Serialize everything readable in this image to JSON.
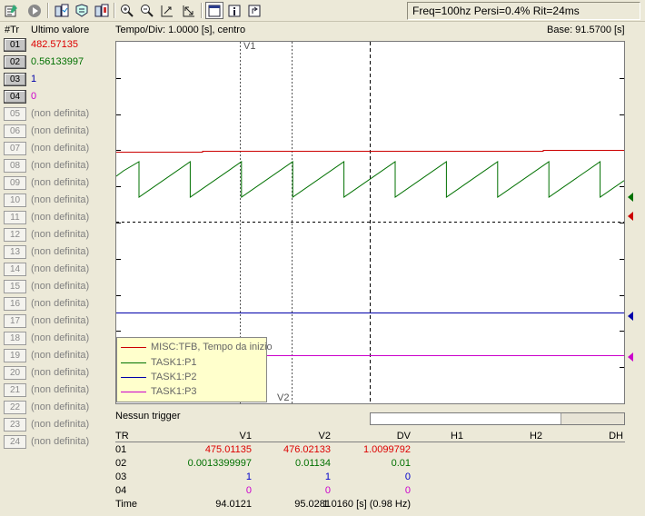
{
  "toolbar": {
    "buttons": [
      {
        "name": "props-button",
        "icon": "properties-icon"
      },
      {
        "name": "play-button",
        "icon": "play-icon"
      },
      {
        "name": "channels-button",
        "icon": "channels-icon"
      },
      {
        "name": "filter-button",
        "icon": "filter-icon"
      },
      {
        "name": "export-button",
        "icon": "export-icon"
      },
      {
        "name": "zoom-in-button",
        "icon": "zoom-in-icon"
      },
      {
        "name": "zoom-out-button",
        "icon": "zoom-out-icon"
      },
      {
        "name": "fit-button",
        "icon": "fit-icon"
      },
      {
        "name": "autoscale-button",
        "icon": "autoscale-icon"
      },
      {
        "name": "view-button",
        "icon": "window-icon"
      },
      {
        "name": "info-button",
        "icon": "info-icon"
      },
      {
        "name": "popout-button",
        "icon": "popout-icon"
      }
    ],
    "status": "Freq=100hz Persi=0.4% Rit=24ms"
  },
  "left": {
    "col_tr": "#Tr",
    "col_value": "Ultimo valore",
    "rows": [
      {
        "id": "01",
        "value": "482.57135",
        "active": true,
        "color": "#dd0000"
      },
      {
        "id": "02",
        "value": "0.56133997",
        "active": true,
        "color": "#007000"
      },
      {
        "id": "03",
        "value": "1",
        "active": true,
        "color": "#0000aa"
      },
      {
        "id": "04",
        "value": "0",
        "active": true,
        "color": "#cc00cc"
      },
      {
        "id": "05",
        "value": "(non definita)",
        "active": false,
        "color": "#808080"
      },
      {
        "id": "06",
        "value": "(non definita)",
        "active": false,
        "color": "#808080"
      },
      {
        "id": "07",
        "value": "(non definita)",
        "active": false,
        "color": "#808080"
      },
      {
        "id": "08",
        "value": "(non definita)",
        "active": false,
        "color": "#808080"
      },
      {
        "id": "09",
        "value": "(non definita)",
        "active": false,
        "color": "#808080"
      },
      {
        "id": "10",
        "value": "(non definita)",
        "active": false,
        "color": "#808080"
      },
      {
        "id": "11",
        "value": "(non definita)",
        "active": false,
        "color": "#808080"
      },
      {
        "id": "12",
        "value": "(non definita)",
        "active": false,
        "color": "#808080"
      },
      {
        "id": "13",
        "value": "(non definita)",
        "active": false,
        "color": "#808080"
      },
      {
        "id": "14",
        "value": "(non definita)",
        "active": false,
        "color": "#808080"
      },
      {
        "id": "15",
        "value": "(non definita)",
        "active": false,
        "color": "#808080"
      },
      {
        "id": "16",
        "value": "(non definita)",
        "active": false,
        "color": "#808080"
      },
      {
        "id": "17",
        "value": "(non definita)",
        "active": false,
        "color": "#808080"
      },
      {
        "id": "18",
        "value": "(non definita)",
        "active": false,
        "color": "#808080"
      },
      {
        "id": "19",
        "value": "(non definita)",
        "active": false,
        "color": "#808080"
      },
      {
        "id": "20",
        "value": "(non definita)",
        "active": false,
        "color": "#808080"
      },
      {
        "id": "21",
        "value": "(non definita)",
        "active": false,
        "color": "#808080"
      },
      {
        "id": "22",
        "value": "(non definita)",
        "active": false,
        "color": "#808080"
      },
      {
        "id": "23",
        "value": "(non definita)",
        "active": false,
        "color": "#808080"
      },
      {
        "id": "24",
        "value": "(non definita)",
        "active": false,
        "color": "#808080"
      }
    ]
  },
  "scope": {
    "tempo_div": "Tempo/Div: 1.0000 [s], centro",
    "base": "Base: 91.5700 [s]",
    "cursor_v1": "V1",
    "cursor_v2": "V2",
    "trigger": "Nessun trigger",
    "progress_fraction": 0.75
  },
  "chart_data": {
    "type": "line",
    "x_unit": "s",
    "xlim": [
      86.57,
      96.57
    ],
    "cursors": {
      "V1": 94.0121,
      "V2": 95.0281
    },
    "series": [
      {
        "name": "MISC:TFB, Tempo da inizio",
        "color": "#cc0000"
      },
      {
        "name": "TASK1:P1",
        "color": "#007000"
      },
      {
        "name": "TASK1:P2",
        "color": "#0000aa"
      },
      {
        "name": "TASK1:P3",
        "color": "#cc00cc"
      }
    ]
  },
  "measure": {
    "headers": [
      "TR",
      "V1",
      "V2",
      "DV",
      "H1",
      "H2",
      "DH"
    ],
    "rows": [
      {
        "tr": "01",
        "v1": "475.01135",
        "v2": "476.02133",
        "dv": "1.0099792",
        "color": "#dd0000"
      },
      {
        "tr": "02",
        "v1": "0.0013399997",
        "v2": "0.01134",
        "dv": "0.01",
        "color": "#007000"
      },
      {
        "tr": "03",
        "v1": "1",
        "v2": "1",
        "dv": "0",
        "color": "#0000cc"
      },
      {
        "tr": "04",
        "v1": "0",
        "v2": "0",
        "dv": "0",
        "color": "#cc00cc"
      }
    ],
    "time": {
      "label": "Time",
      "v1": "94.0121",
      "v2": "95.0281",
      "dv": "1.0160 [s] (0.98  Hz)"
    }
  }
}
